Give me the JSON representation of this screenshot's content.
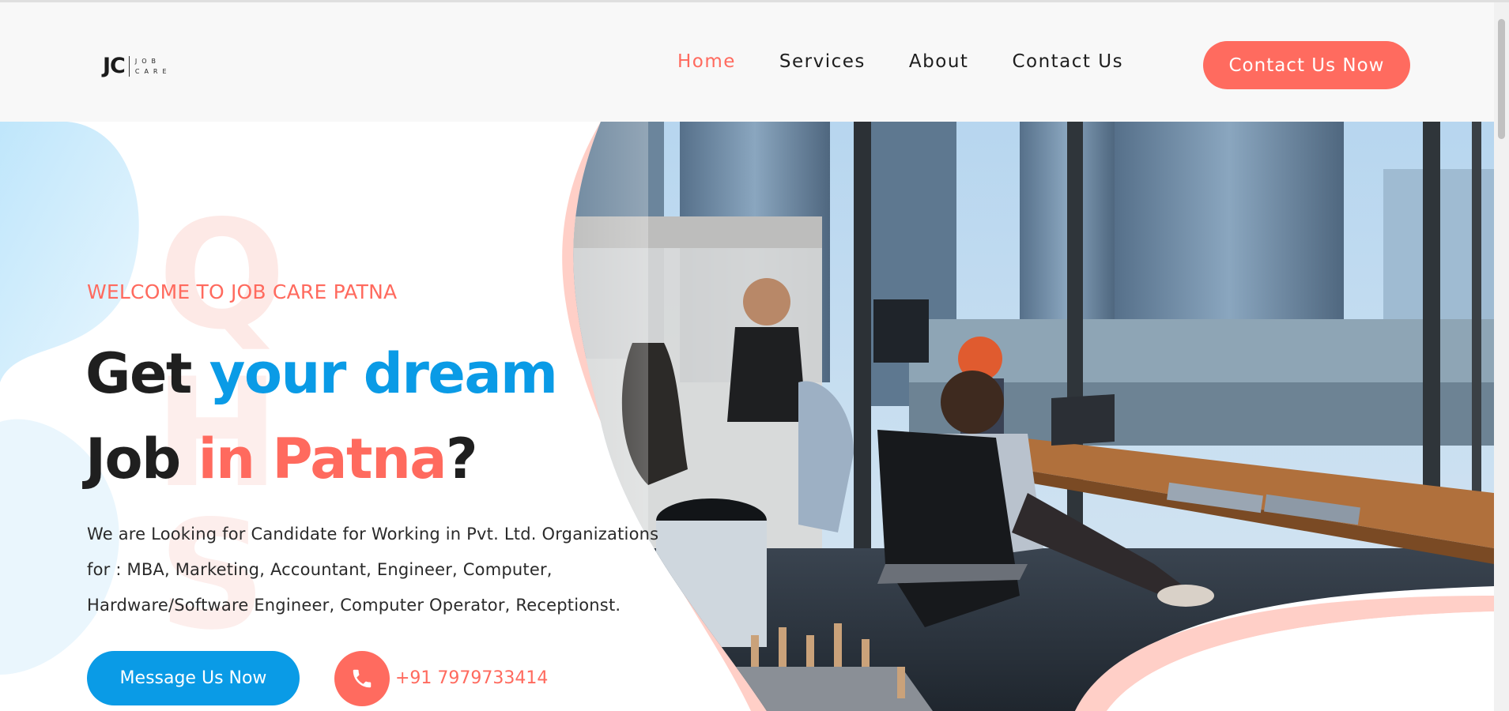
{
  "header": {
    "logo": {
      "mark": "JC",
      "word1": "JOB",
      "word2": "CARE"
    },
    "nav": [
      {
        "label": "Home"
      },
      {
        "label": "Services"
      },
      {
        "label": "About"
      },
      {
        "label": "Contact Us"
      }
    ],
    "cta_label": "Contact Us Now"
  },
  "hero": {
    "welcome": "WELCOME TO JOB CARE PATNA",
    "headline": {
      "line1_a": "Get ",
      "line1_b": "your dream",
      "line2_a": "Job ",
      "line2_b": "in Patna",
      "line2_c": "?"
    },
    "description": {
      "line1": "We are Looking for Candidate for Working in Pvt. Ltd. Organizations",
      "line2": "for : MBA, Marketing, Accountant, Engineer, Computer,",
      "line3": "Hardware/Software Engineer, Computer Operator, Receptionst."
    },
    "message_button_label": "Message Us Now",
    "phone_icon": "phone-icon",
    "phone_number": "+91 7979733414"
  },
  "colors": {
    "accent_coral": "#ff6a5e",
    "accent_blue": "#0a9be6",
    "header_bg": "#f8f8f8"
  }
}
